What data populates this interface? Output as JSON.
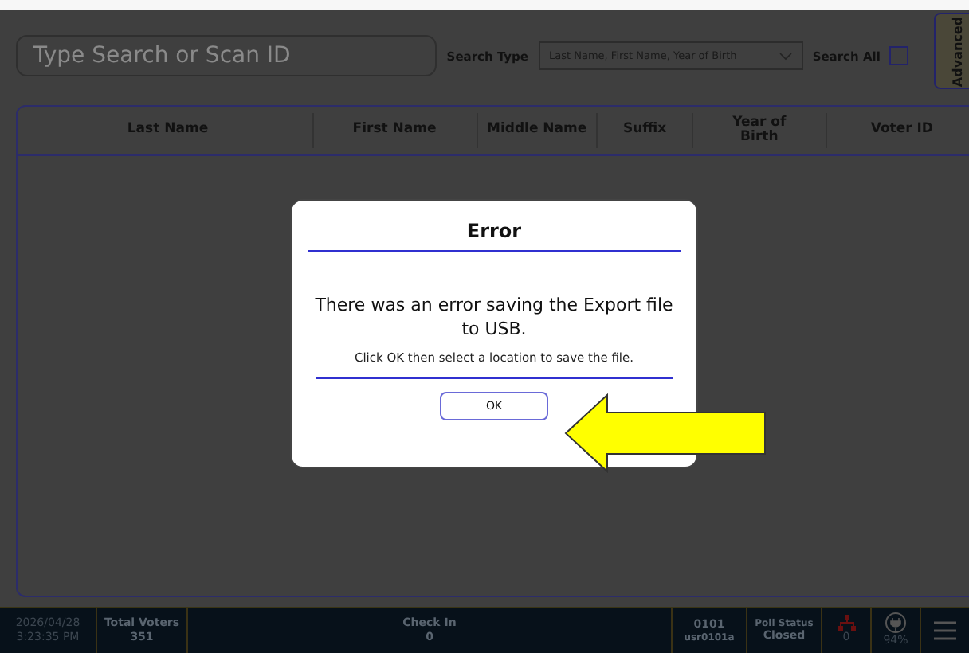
{
  "search": {
    "placeholder": "Type Search or Scan ID",
    "type_label": "Search Type",
    "type_value": "Last Name, First Name, Year of Birth",
    "all_label": "Search All",
    "all_checked": false,
    "advanced_button": "Advanced"
  },
  "table": {
    "columns": [
      "Last Name",
      "First Name",
      "Middle Name",
      "Suffix",
      "Year of Birth",
      "Voter ID"
    ]
  },
  "dialog": {
    "title": "Error",
    "message": "There was an error saving the Export file to USB.",
    "hint": "Click OK then select a location to save the file.",
    "button": "OK"
  },
  "status_bar": {
    "date": "2026/04/28",
    "time": "3:23:35 PM",
    "total_label": "Total Voters",
    "total_value": "351",
    "checkin_label": "Check In",
    "checkin_value": "0",
    "precinct": "0101",
    "user": "usr0101a",
    "poll_label": "Poll Status",
    "poll_value": "Closed",
    "network_count": "0",
    "battery": "94%"
  }
}
